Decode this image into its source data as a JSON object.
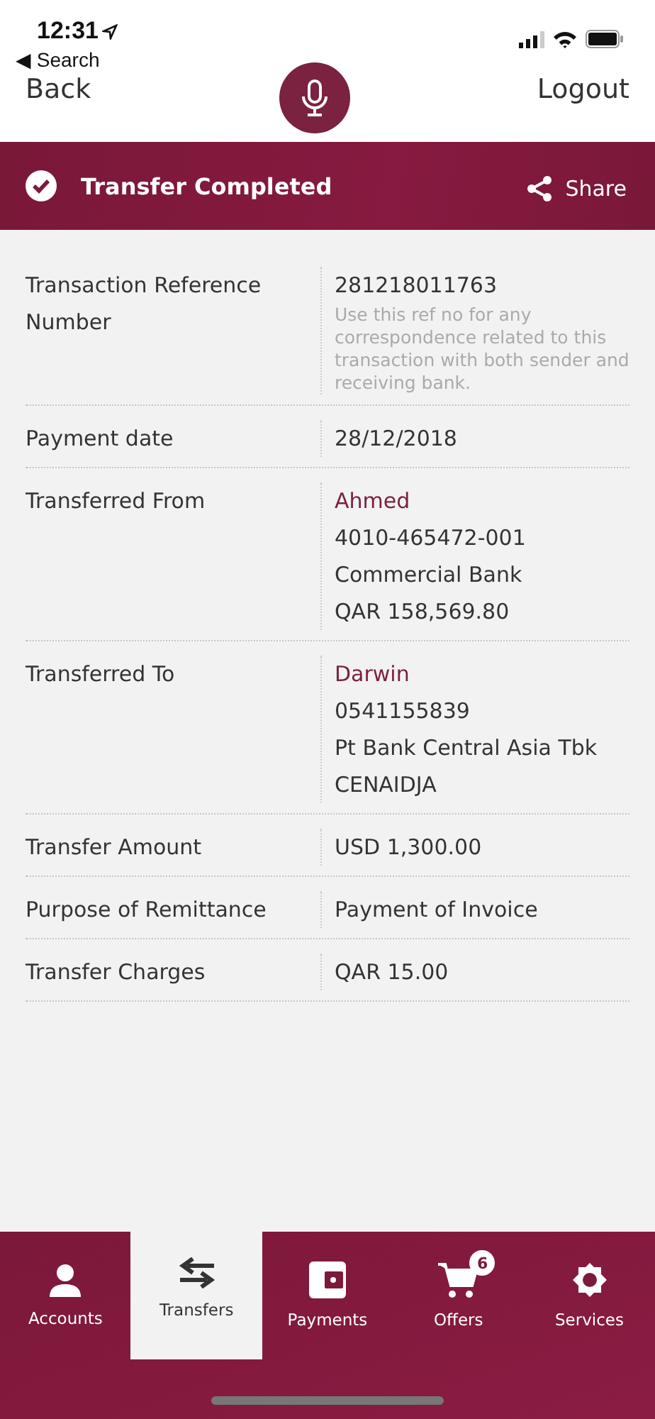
{
  "status_bar": {
    "time": "12:31",
    "back_app": "◀ Search"
  },
  "nav": {
    "back": "Back",
    "logout": "Logout"
  },
  "banner": {
    "title": "Transfer Completed",
    "share": "Share"
  },
  "details": [
    {
      "label": "Transaction Reference Number",
      "values": [
        {
          "kind": "plain",
          "text": "281218011763"
        },
        {
          "kind": "note",
          "text": "Use this ref no for any correspondence related to this transaction with both sender and receiving bank."
        }
      ]
    },
    {
      "label": "Payment date",
      "values": [
        {
          "kind": "plain",
          "text": "28/12/2018"
        }
      ]
    },
    {
      "label": "Transferred From",
      "values": [
        {
          "kind": "name",
          "text": "Ahmed"
        },
        {
          "kind": "plain",
          "text": "4010-465472-001"
        },
        {
          "kind": "plain",
          "text": "Commercial Bank"
        },
        {
          "kind": "plain",
          "text": "QAR 158,569.80"
        }
      ]
    },
    {
      "label": "Transferred To",
      "values": [
        {
          "kind": "name",
          "text": "Darwin"
        },
        {
          "kind": "plain",
          "text": "0541155839"
        },
        {
          "kind": "plain",
          "text": "Pt Bank Central Asia Tbk"
        },
        {
          "kind": "plain",
          "text": "CENAIDJA"
        }
      ]
    },
    {
      "label": "Transfer Amount",
      "values": [
        {
          "kind": "plain",
          "text": "USD 1,300.00"
        }
      ]
    },
    {
      "label": "Purpose of Remittance",
      "values": [
        {
          "kind": "plain",
          "text": "Payment of Invoice"
        }
      ]
    },
    {
      "label": "Transfer Charges",
      "values": [
        {
          "kind": "plain",
          "text": "QAR 15.00"
        }
      ]
    }
  ],
  "tabs": [
    {
      "label": "Accounts",
      "kind": "person",
      "selected": false
    },
    {
      "label": "Transfers",
      "kind": "arrows",
      "selected": true
    },
    {
      "label": "Payments",
      "kind": "wallet",
      "selected": false
    },
    {
      "label": "Offers",
      "kind": "cart",
      "selected": false,
      "badge": "6"
    },
    {
      "label": "Services",
      "kind": "gear",
      "selected": false
    }
  ]
}
